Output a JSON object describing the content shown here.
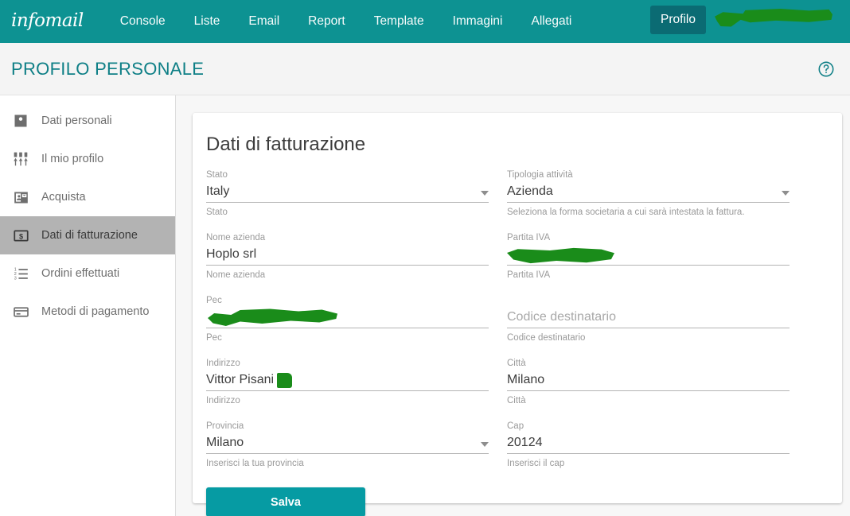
{
  "brand": {
    "logo_text": "infomail",
    "teal": "#0d9292",
    "accent": "#069ba3",
    "redaction_green": "#1a8c1a"
  },
  "topnav": {
    "links": [
      {
        "label": "Console"
      },
      {
        "label": "Liste"
      },
      {
        "label": "Email"
      },
      {
        "label": "Report"
      },
      {
        "label": "Template"
      },
      {
        "label": "Immagini"
      },
      {
        "label": "Allegati"
      }
    ],
    "profile_button": "Profilo",
    "account_name_redacted": ""
  },
  "pageheader": {
    "title": "PROFILO PERSONALE",
    "help_icon": "help-circle-icon"
  },
  "sidebar": {
    "items": [
      {
        "label": "Dati personali",
        "icon": "account-box-icon",
        "active": false
      },
      {
        "label": "Il mio profilo",
        "icon": "tune-sliders-icon",
        "active": false
      },
      {
        "label": "Acquista",
        "icon": "contact-mail-icon",
        "active": false
      },
      {
        "label": "Dati di fatturazione",
        "icon": "dollar-box-icon",
        "active": true
      },
      {
        "label": "Ordini effettuati",
        "icon": "format-list-numbered-icon",
        "active": false
      },
      {
        "label": "Metodi di pagamento",
        "icon": "credit-card-icon",
        "active": false
      }
    ]
  },
  "form": {
    "title": "Dati di fatturazione",
    "fields": {
      "stato": {
        "label": "Stato",
        "value": "Italy",
        "hint": "Stato",
        "type": "select"
      },
      "tipologia": {
        "label": "Tipologia attività",
        "value": "Azienda",
        "hint": "Seleziona la forma societaria a cui sarà intestata la fattura.",
        "type": "select"
      },
      "nome_azienda": {
        "label": "Nome azienda",
        "value": "Hoplo srl",
        "hint": "Nome azienda",
        "type": "text"
      },
      "partita_iva": {
        "label": "Partita IVA",
        "value": "",
        "hint": "Partita IVA",
        "type": "text",
        "redacted": true
      },
      "pec": {
        "label": "Pec",
        "value": "",
        "hint": "Pec",
        "type": "text",
        "redacted": true
      },
      "codice_destinatario": {
        "label": "",
        "value": "",
        "placeholder": "Codice destinatario",
        "hint": "Codice destinatario",
        "type": "text"
      },
      "indirizzo": {
        "label": "Indirizzo",
        "value": "Vittor Pisani",
        "hint": "Indirizzo",
        "type": "text",
        "redacted": true
      },
      "citta": {
        "label": "Città",
        "value": "Milano",
        "hint": "Città",
        "type": "text"
      },
      "provincia": {
        "label": "Provincia",
        "value": "Milano",
        "hint": "Inserisci la tua provincia",
        "type": "select"
      },
      "cap": {
        "label": "Cap",
        "value": "20124",
        "hint": "Inserisci il cap",
        "type": "text"
      }
    },
    "save_button": "Salva"
  }
}
